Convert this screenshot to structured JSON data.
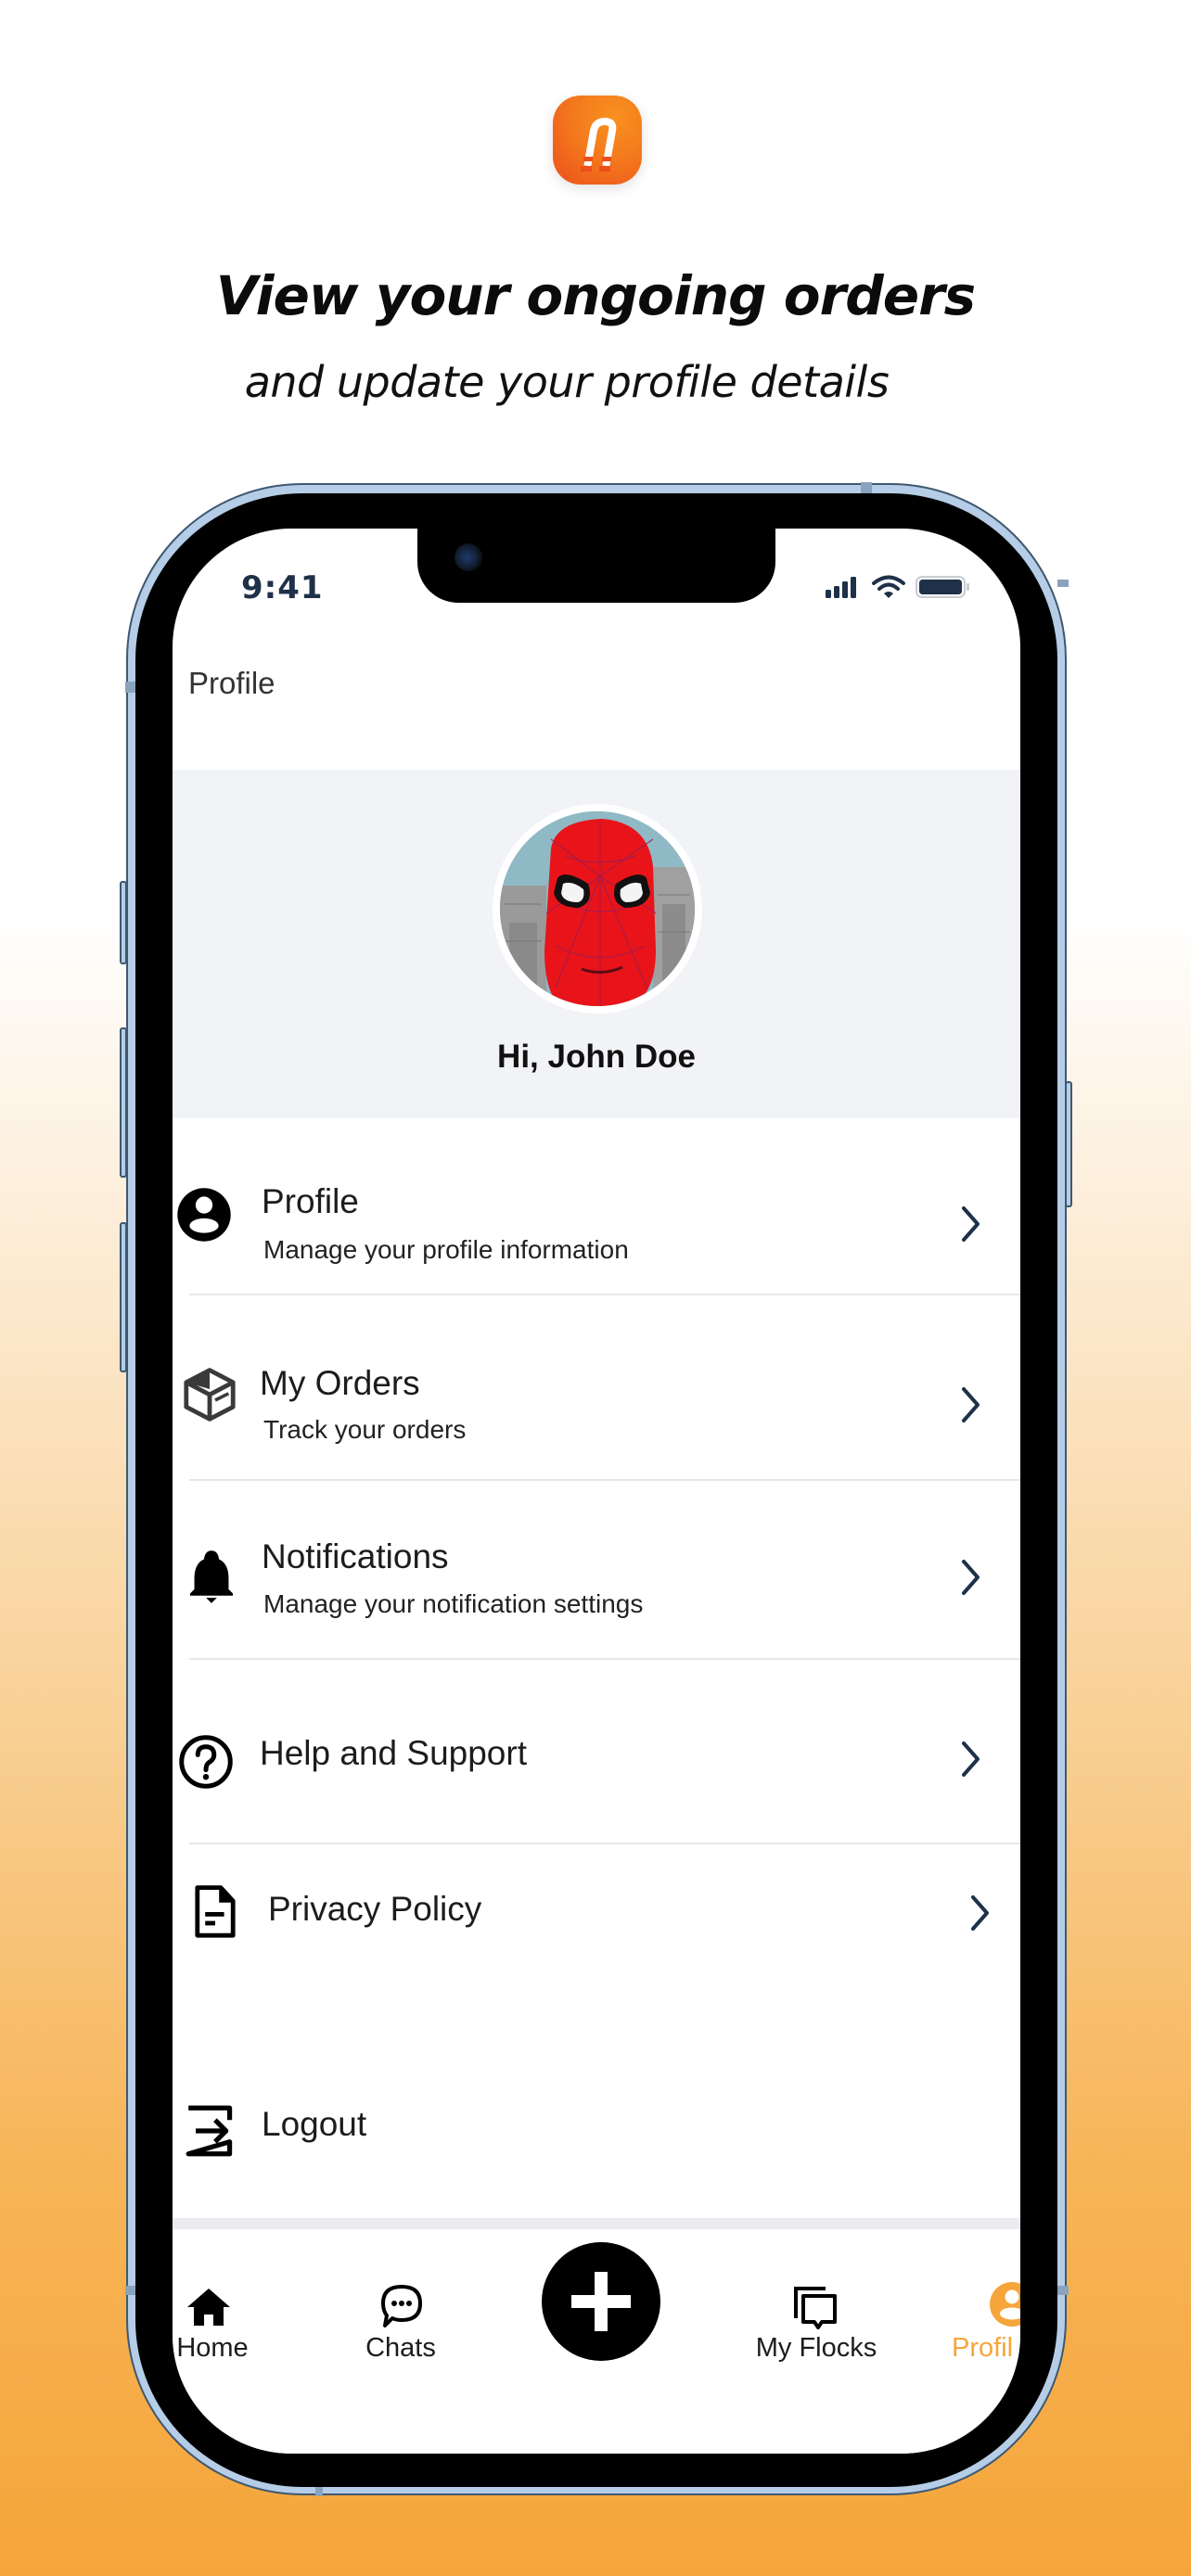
{
  "promo": {
    "headline": "View your ongoing orders",
    "subheadline": "and update your profile details"
  },
  "status_bar": {
    "time": "9:41",
    "icons": [
      "cellular-signal-icon",
      "wifi-icon",
      "battery-icon"
    ]
  },
  "header": {
    "title": "Profile"
  },
  "profile": {
    "greeting": "Hi, John Doe",
    "avatar_description": "spider-man mask avatar"
  },
  "menu": {
    "items": [
      {
        "icon": "user-circle-icon",
        "title": "Profile",
        "subtitle": "Manage your profile information",
        "has_chevron": true
      },
      {
        "icon": "box-icon",
        "title": "My Orders",
        "subtitle": "Track your orders",
        "has_chevron": true
      },
      {
        "icon": "bell-icon",
        "title": "Notifications",
        "subtitle": "Manage your notification settings",
        "has_chevron": true
      },
      {
        "icon": "help-circle-icon",
        "title": "Help and Support",
        "has_chevron": true
      },
      {
        "icon": "document-icon",
        "title": "Privacy Policy",
        "has_chevron": true
      },
      {
        "icon": "logout-icon",
        "title": "Logout",
        "has_chevron": false
      }
    ]
  },
  "tabbar": {
    "tabs": [
      {
        "icon": "home-icon",
        "label": "Home",
        "active": false
      },
      {
        "icon": "chat-bubble-icon",
        "label": "Chats",
        "active": false
      },
      {
        "icon": "plus-icon",
        "label": "",
        "active": false
      },
      {
        "icon": "stacked-cards-icon",
        "label": "My Flocks",
        "active": false
      },
      {
        "icon": "user-circle-icon",
        "label": "Profil",
        "active": true
      }
    ]
  },
  "colors": {
    "brand_orange": "#F47A1D",
    "active_tab": "#F6A53A",
    "background_bottom": "#F6A53A",
    "chevron": "#1E3148",
    "profile_band": "#F1F3F6"
  }
}
